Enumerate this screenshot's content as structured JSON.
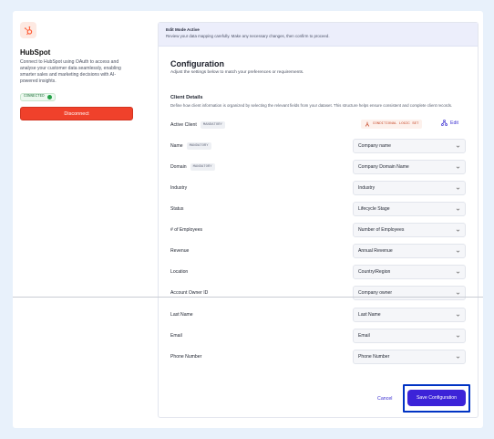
{
  "app": {
    "name": "HubSpot",
    "description": "Connect to HubSpot using OAuth to access and analyse your customer data seamlessly, enabling smarter sales and marketing decisions with AI-powered insights.",
    "status": "CONNECTED",
    "disconnect_label": "Disconnect",
    "logo_icon": "hubspot-sprocket-icon",
    "brand_color": "#ff5c35"
  },
  "banner": {
    "title": "Edit Mode Active",
    "subtitle": "Review your data mapping carefully. Make any necessary changes, then confirm to proceed."
  },
  "configuration": {
    "title": "Configuration",
    "subtitle": "Adjust the settings below to match your preferences or requirements."
  },
  "client_details": {
    "title": "Client Details",
    "description": "Define how client information is organized by selecting the relevant fields from your dataset. This structure helps ensure consistent and complete client records.",
    "active_client_label": "Active Client",
    "mandatory_badge": "MANDATORY",
    "conditional_badge": "CONDITIONAL LOGIC SET",
    "edit_label": "Edit"
  },
  "fields": [
    {
      "label": "Name",
      "mandatory": "MANDATORY",
      "value": "Company name"
    },
    {
      "label": "Domain",
      "mandatory": "MANDATORY",
      "value": "Company Domain Name"
    },
    {
      "label": "Industry",
      "mandatory": "",
      "value": "Industry"
    },
    {
      "label": "Status",
      "mandatory": "",
      "value": "Lifecycle Stage"
    },
    {
      "label": "# of Employees",
      "mandatory": "",
      "value": "Number of Employees"
    },
    {
      "label": "Revenue",
      "mandatory": "",
      "value": "Annual Revenue"
    },
    {
      "label": "Location",
      "mandatory": "",
      "value": "Country/Region"
    },
    {
      "label": "Account Owner ID",
      "mandatory": "",
      "value": "Company owner"
    },
    {
      "label": "Last Name",
      "mandatory": "",
      "value": "Last Name"
    },
    {
      "label": "Email",
      "mandatory": "",
      "value": "Email"
    },
    {
      "label": "Phone Number",
      "mandatory": "",
      "value": "Phone Number"
    }
  ],
  "footer": {
    "cancel_label": "Cancel",
    "save_label": "Save Configuration"
  },
  "colors": {
    "accent": "#3c23d8",
    "danger": "#f0412b",
    "success": "#24a148",
    "highlight_outline": "#0033c4"
  }
}
